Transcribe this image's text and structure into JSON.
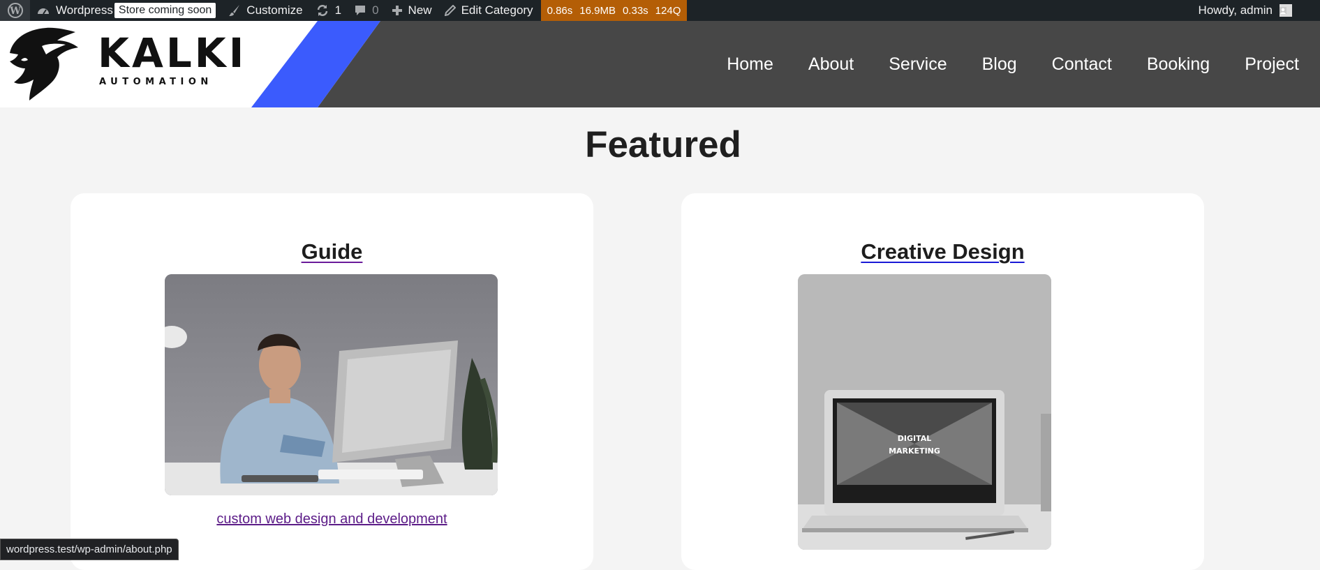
{
  "adminbar": {
    "site_name": "Wordpress",
    "store_badge": "Store coming soon",
    "customize": "Customize",
    "updates_count": "1",
    "comments_count": "0",
    "new_label": "New",
    "edit_category": "Edit Category",
    "query_monitor": {
      "time": "0.86s",
      "memory": "16.9MB",
      "db_time": "0.33s",
      "queries": "124Q"
    },
    "greeting": "Howdy, admin"
  },
  "header": {
    "brand_name": "KALKI",
    "brand_sub": "AUTOMATION",
    "nav": [
      "Home",
      "About",
      "Service",
      "Blog",
      "Contact",
      "Booking",
      "Project"
    ]
  },
  "main": {
    "title": "Featured",
    "cards": [
      {
        "title": "Guide",
        "link": "custom web design and development"
      },
      {
        "title": "Creative Design",
        "laptop_text": "DIGITAL MARKETING"
      }
    ]
  },
  "statusbar": {
    "url": "wordpress.test/wp-admin/about.php"
  },
  "colors": {
    "adminbar": "#1d2327",
    "header": "#474747",
    "accent_blue": "#3b5bfd",
    "query_monitor": "#b45e06",
    "link_purple": "#5b1b87"
  }
}
